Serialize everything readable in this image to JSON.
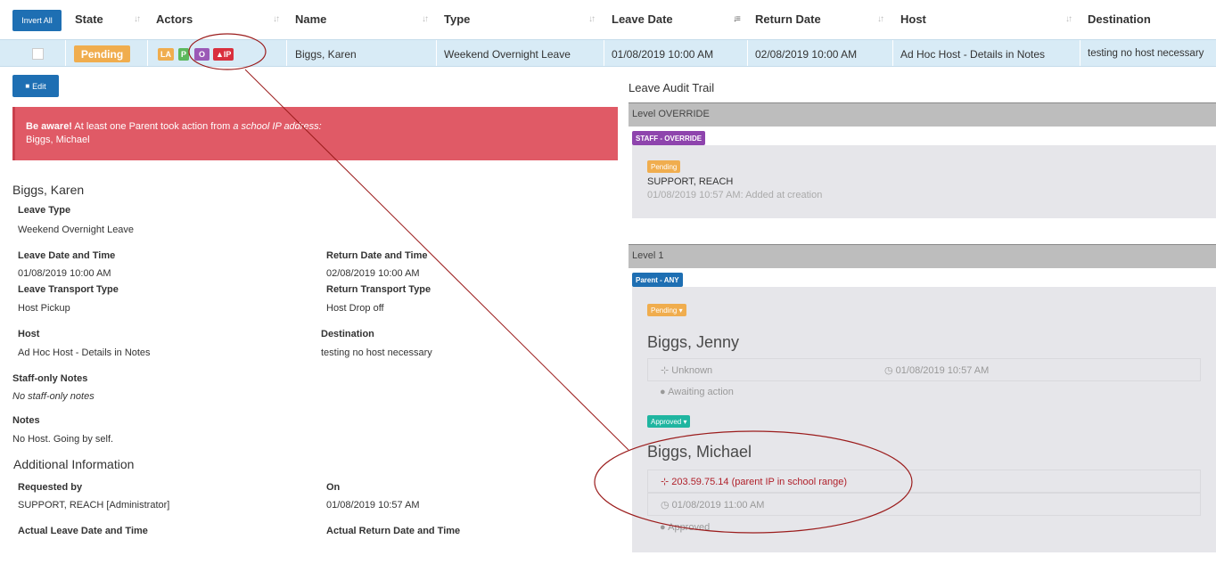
{
  "table": {
    "invert_label": "Invert All",
    "headers": {
      "state": "State",
      "actors": "Actors",
      "name": "Name",
      "type": "Type",
      "leave_date": "Leave Date",
      "return_date": "Return Date",
      "host": "Host",
      "destination": "Destination"
    },
    "row": {
      "state": "Pending",
      "actors": [
        "LA",
        "P",
        "O",
        "IP"
      ],
      "name": "Biggs, Karen",
      "type": "Weekend Overnight Leave",
      "leave_date": "01/08/2019 10:00 AM",
      "return_date": "02/08/2019 10:00 AM",
      "host": "Ad Hoc Host - Details in Notes",
      "destination": "testing no host necessary"
    }
  },
  "edit_label": "Edit",
  "alert": {
    "bold": "Be aware!",
    "text": " At least one Parent took action from ",
    "italic": "a school IP address:",
    "name": "Biggs, Michael"
  },
  "details": {
    "student_name": "Biggs, Karen",
    "leave_type_label": "Leave Type",
    "leave_type": "Weekend Overnight Leave",
    "leave_dt_label": "Leave Date and Time",
    "leave_dt": "01/08/2019 10:00 AM",
    "return_dt_label": "Return Date and Time",
    "return_dt": "02/08/2019 10:00 AM",
    "leave_transport_label": "Leave Transport Type",
    "leave_transport": "Host Pickup",
    "return_transport_label": "Return Transport Type",
    "return_transport": "Host Drop off",
    "host_label": "Host",
    "host": "Ad Hoc Host - Details in Notes",
    "destination_label": "Destination",
    "destination": "testing no host necessary",
    "staff_notes_label": "Staff-only Notes",
    "staff_notes": "No staff-only notes",
    "notes_label": "Notes",
    "notes": "No Host. Going by self.",
    "additional_title": "Additional Information",
    "requested_by_label": "Requested by",
    "requested_by": "SUPPORT, REACH [Administrator]",
    "on_label": "On",
    "on": "01/08/2019 10:57 AM",
    "actual_leave_label": "Actual Leave Date and Time",
    "actual_return_label": "Actual Return Date and Time"
  },
  "audit": {
    "title": "Leave Audit Trail",
    "level_override": "Level OVERRIDE",
    "override_role": "STAFF - OVERRIDE",
    "override_status": "Pending",
    "override_actor": "SUPPORT, REACH",
    "override_note": "01/08/2019 10:57 AM: Added at creation",
    "level1": "Level 1",
    "level1_role": "Parent - ANY",
    "jenny_status": "Pending ▾",
    "jenny_name": "Biggs, Jenny",
    "jenny_ip": "Unknown",
    "jenny_time": "01/08/2019 10:57 AM",
    "jenny_action": "Awaiting action",
    "michael_status": "Approved ▾",
    "michael_name": "Biggs, Michael",
    "michael_ip": "203.59.75.14 (parent IP in school range)",
    "michael_time": "01/08/2019 11:00 AM",
    "michael_action": "Approved"
  },
  "colors": {
    "primary": "#1e6fb3",
    "pending": "#f0ad4e",
    "approved": "#1fb5a0",
    "danger": "#e05a66",
    "override": "#8e44ad",
    "annotation": "#9b1c1c"
  }
}
